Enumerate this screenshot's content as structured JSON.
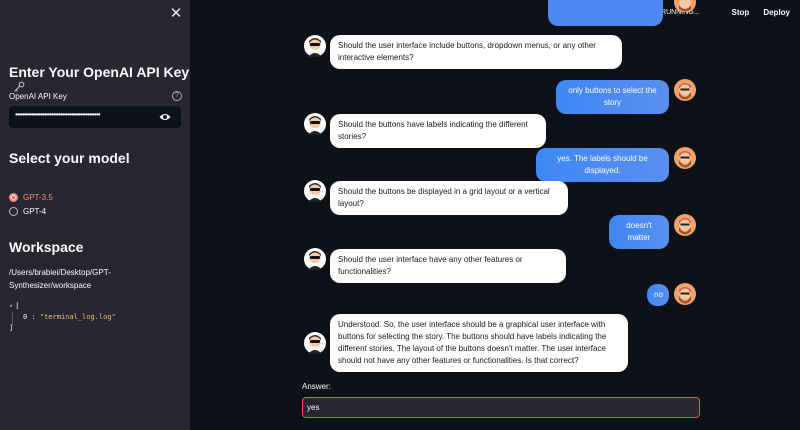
{
  "sidebar": {
    "close_glyph": "✕",
    "api_heading": "Enter Your OpenAI API Key",
    "api_heading_icon": "key-icon",
    "api_label": "OpenAI API Key",
    "api_value_mask": "•••••••••••••••••••••••••••••••••••••••••••••••",
    "model_heading": "Select your model",
    "models": [
      {
        "label": "GPT-3.5",
        "selected": true
      },
      {
        "label": "GPT-4",
        "selected": false
      }
    ],
    "workspace_heading": "Workspace",
    "workspace_path": "/Users/brabiei/Desktop/GPT-Synthesizer/workspace",
    "json_open": "[",
    "json_item_index": "0 :",
    "json_item_value": "\"terminal_log.log\"",
    "json_close": "]"
  },
  "header": {
    "status": "RUNNING...",
    "stop_label": "Stop",
    "deploy_label": "Deploy"
  },
  "chat": {
    "messages": [
      {
        "role": "assistant",
        "text": "Should the user interface include buttons, dropdown menus, or any other interactive elements?"
      },
      {
        "role": "user",
        "text": "only buttons to select the story"
      },
      {
        "role": "assistant",
        "text": "Should the buttons have labels indicating the different stories?"
      },
      {
        "role": "user",
        "text": "yes. The labels should be displayed."
      },
      {
        "role": "assistant",
        "text": "Should the buttons be displayed in a grid layout or a vertical layout?"
      },
      {
        "role": "user",
        "text": "doesn't matter"
      },
      {
        "role": "assistant",
        "text": "Should the user interface have any other features or functionalities?"
      },
      {
        "role": "user",
        "text": "no"
      },
      {
        "role": "assistant",
        "text": "Understood. So, the user interface should be a graphical user interface with buttons for selecting the story. The buttons should have labels indicating the different stories. The layout of the buttons doesn't matter. The user interface should not have any other features or functionalities. Is that correct?"
      }
    ],
    "answer_label": "Answer:",
    "answer_value": "yes"
  },
  "colors": {
    "background": "#0e1117",
    "sidebar": "#262730",
    "accent": "#ff4b4b",
    "user_bubble": "#4a8af2"
  }
}
